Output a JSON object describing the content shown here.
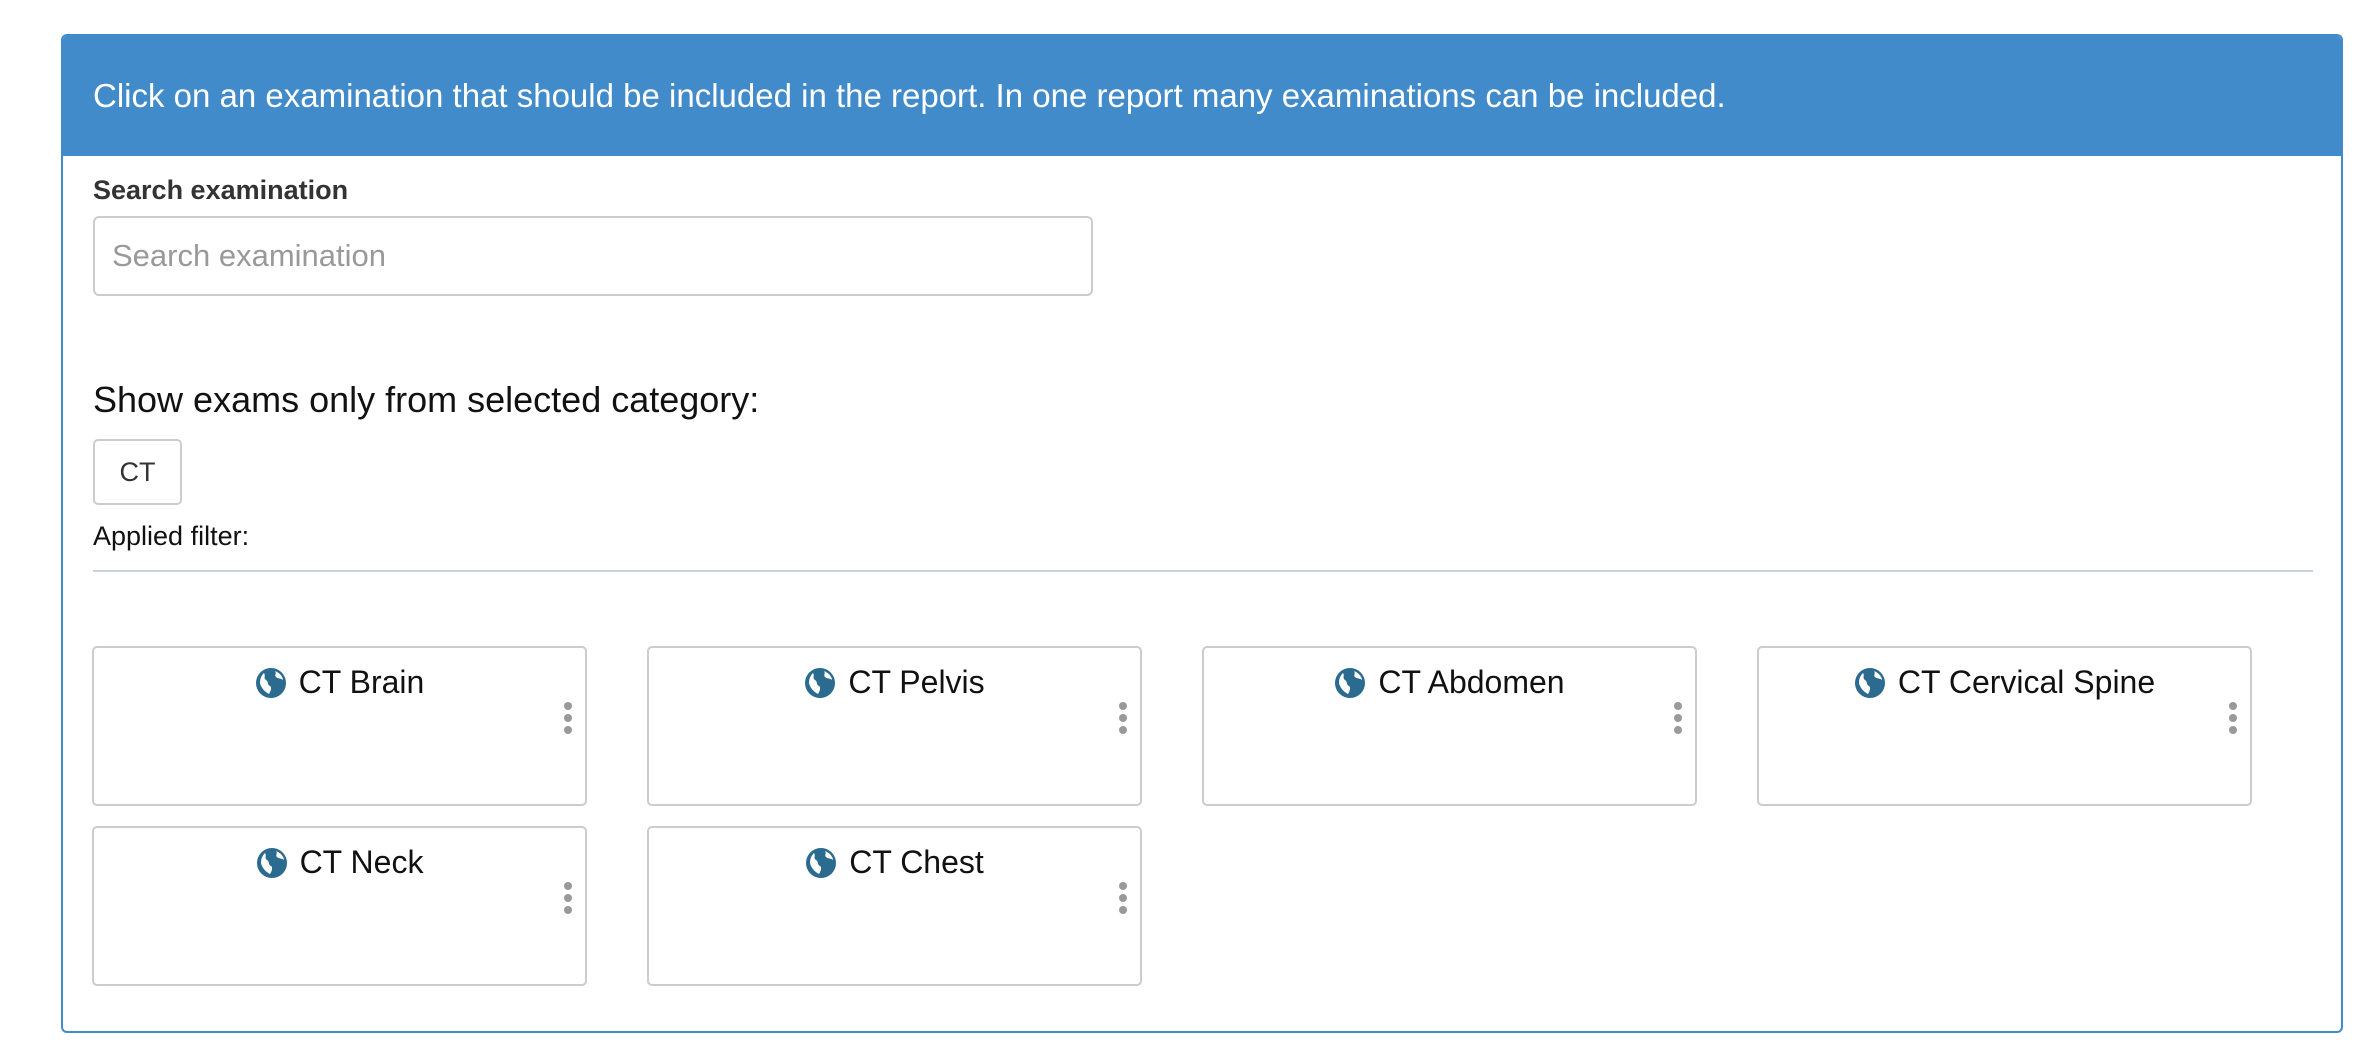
{
  "panel": {
    "heading": "Click on an examination that should be included in the report. In one report many examinations can be included."
  },
  "search": {
    "label": "Search examination",
    "placeholder": "Search examination",
    "value": ""
  },
  "category": {
    "heading": "Show exams only from selected category:",
    "options": [
      "CT"
    ],
    "button_label": "CT"
  },
  "filter": {
    "applied_label": "Applied filter:"
  },
  "exams": [
    {
      "title": "CT Brain",
      "icon": "globe-icon"
    },
    {
      "title": "CT Pelvis",
      "icon": "globe-icon"
    },
    {
      "title": "CT Abdomen",
      "icon": "globe-icon"
    },
    {
      "title": "CT Cervical Spine",
      "icon": "globe-icon"
    },
    {
      "title": "CT Neck",
      "icon": "globe-icon"
    },
    {
      "title": "CT Chest",
      "icon": "globe-icon"
    }
  ],
  "colors": {
    "accent": "#428bca",
    "icon": "#2a6b8f"
  }
}
